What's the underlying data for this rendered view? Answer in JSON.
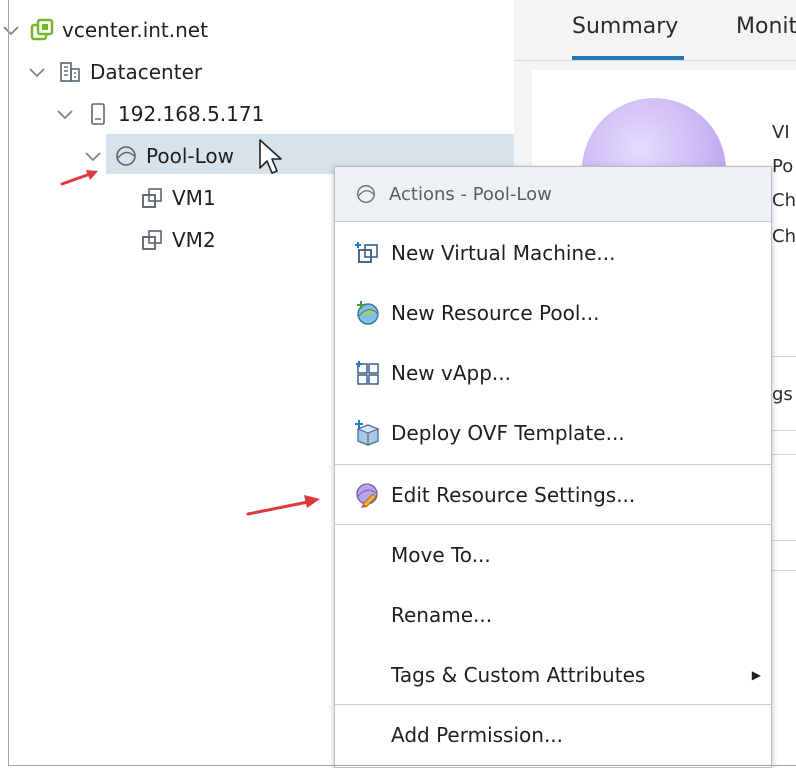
{
  "tree": {
    "nodes": [
      {
        "label": "vcenter.int.net",
        "icon": "vcenter-icon"
      },
      {
        "label": "Datacenter",
        "icon": "datacenter-icon"
      },
      {
        "label": "192.168.5.171",
        "icon": "host-icon"
      },
      {
        "label": "Pool-Low",
        "icon": "resource-pool-icon"
      },
      {
        "label": "VM1",
        "icon": "vm-icon"
      },
      {
        "label": "VM2",
        "icon": "vm-icon"
      }
    ]
  },
  "tabs": [
    {
      "label": "Summary",
      "active": true
    },
    {
      "label": "Monit",
      "active": false
    }
  ],
  "summary": {
    "truncated_labels": [
      "VI",
      "Po",
      "Ch",
      "Ch"
    ],
    "tags_fragment": "gs"
  },
  "context_menu": {
    "header": "Actions - Pool-Low",
    "items": [
      {
        "label": "New Virtual Machine...",
        "icon": "new-vm-icon"
      },
      {
        "label": "New Resource Pool...",
        "icon": "new-resource-pool-icon"
      },
      {
        "label": "New vApp...",
        "icon": "new-vapp-icon"
      },
      {
        "label": "Deploy OVF Template...",
        "icon": "deploy-ovf-icon"
      },
      {
        "label": "Edit Resource Settings...",
        "icon": "edit-resource-settings-icon"
      },
      {
        "label": "Move To..."
      },
      {
        "label": "Rename..."
      },
      {
        "label": "Tags & Custom Attributes",
        "submenu": true
      },
      {
        "label": "Add Permission..."
      }
    ]
  },
  "colors": {
    "selection": "#d8e2ea",
    "tab_underline": "#1f7ab8",
    "annotation_arrow": "#e0383e",
    "vcenter_logo": "#74b72e"
  }
}
